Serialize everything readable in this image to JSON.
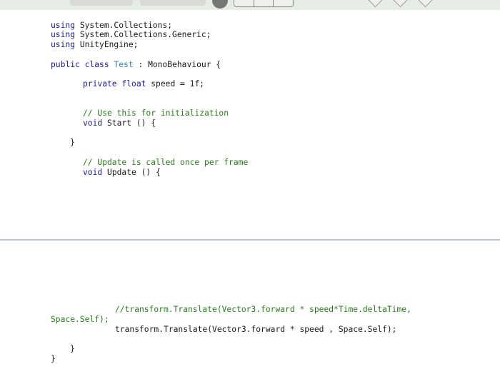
{
  "toolbar": {
    "buttons": [
      "toolbar-pill",
      "toolbar-pill",
      "record-circle",
      "format-group",
      "nav-diamond",
      "nav-diamond",
      "nav-diamond"
    ]
  },
  "code_top": {
    "l1_kw": "using",
    "l1_rest": " System.Collections;",
    "l2_kw": "using",
    "l2_rest": " System.Collections.Generic;",
    "l3_kw": "using",
    "l3_rest": " UnityEngine;",
    "l4_kw1": "public",
    "l4_kw2": "class",
    "l4_type": "Test",
    "l4_rest": " : MonoBehaviour {",
    "l5_kw1": "private",
    "l5_kw2": "float",
    "l5_rest": " speed = 1f;",
    "l6_cm": "// Use this for initialization",
    "l7_kw": "void",
    "l7_rest": " Start () {",
    "l8": "}",
    "l9_cm": "// Update is called once per frame",
    "l10_kw": "void",
    "l10_rest": " Update () {"
  },
  "code_bottom": {
    "l11_cm": "//transform.Translate(Vector3.forward * speed*Time.deltaTime,",
    "l12_cm": "Space.Self);",
    "l13": "transform.Translate(Vector3.forward * speed , Space.Self);",
    "l14": "}",
    "l15": "}"
  }
}
